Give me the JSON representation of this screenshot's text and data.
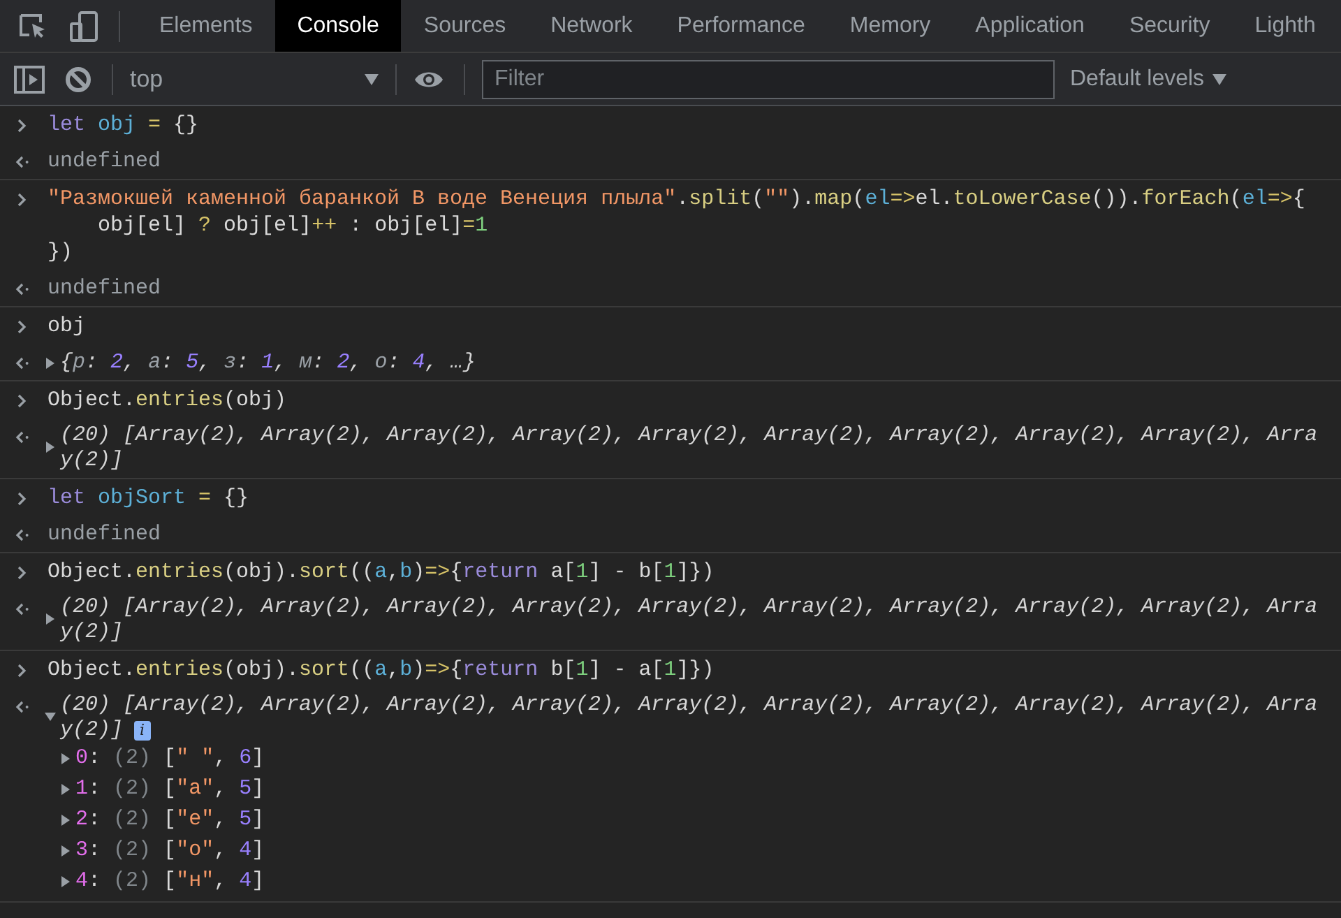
{
  "tabs": [
    {
      "label": "Elements",
      "selected": false
    },
    {
      "label": "Console",
      "selected": true
    },
    {
      "label": "Sources",
      "selected": false
    },
    {
      "label": "Network",
      "selected": false
    },
    {
      "label": "Performance",
      "selected": false
    },
    {
      "label": "Memory",
      "selected": false
    },
    {
      "label": "Application",
      "selected": false
    },
    {
      "label": "Security",
      "selected": false
    },
    {
      "label": "Lighth",
      "selected": false
    }
  ],
  "toolbar": {
    "context": "top",
    "filter_placeholder": "Filter",
    "levels": "Default levels"
  },
  "entries": [
    {
      "command": [
        [
          {
            "keyword": "let "
          },
          {
            "variable": "obj "
          },
          {
            "operator": "= "
          },
          {
            "plain": "{}"
          }
        ]
      ],
      "result": {
        "kind": "text",
        "text": "undefined"
      }
    },
    {
      "command": [
        [
          {
            "string": "\"Размокшей каменной баранкой В воде Венеция плыла\""
          },
          {
            "plain": "."
          },
          {
            "function": "split"
          },
          {
            "plain": "("
          },
          {
            "string": "\"\""
          },
          {
            "plain": ")."
          },
          {
            "function": "map"
          },
          {
            "plain": "("
          },
          {
            "variable": "el"
          },
          {
            "operator": "=>"
          },
          {
            "plain": "el."
          },
          {
            "function": "toLowerCase"
          },
          {
            "plain": "())."
          },
          {
            "function": "forEach"
          },
          {
            "plain": "("
          },
          {
            "variable": "el"
          },
          {
            "operator": "=>"
          },
          {
            "plain": "{"
          }
        ],
        [
          {
            "plain": "    obj[el] "
          },
          {
            "operator": "?"
          },
          {
            "plain": " obj[el]"
          },
          {
            "operator": "++"
          },
          {
            "plain": " : obj[el]"
          },
          {
            "operator": "="
          },
          {
            "number": "1"
          }
        ],
        [
          {
            "plain": "})"
          }
        ]
      ],
      "result": {
        "kind": "text",
        "text": "undefined"
      }
    },
    {
      "command": [
        [
          {
            "plain": "obj"
          }
        ]
      ],
      "result": {
        "kind": "object",
        "expanded": false,
        "tokens": [
          {
            "punct": "{"
          },
          {
            "key": "р"
          },
          {
            "punct": ": "
          },
          {
            "value": "2"
          },
          {
            "punct": ", "
          },
          {
            "key": "а"
          },
          {
            "punct": ": "
          },
          {
            "value": "5"
          },
          {
            "punct": ", "
          },
          {
            "key": "з"
          },
          {
            "punct": ": "
          },
          {
            "value": "1"
          },
          {
            "punct": ", "
          },
          {
            "key": "м"
          },
          {
            "punct": ": "
          },
          {
            "value": "2"
          },
          {
            "punct": ", "
          },
          {
            "key": "о"
          },
          {
            "punct": ": "
          },
          {
            "value": "4"
          },
          {
            "punct": ", …}"
          }
        ]
      }
    },
    {
      "command": [
        [
          {
            "plain": "Object."
          },
          {
            "function": "entries"
          },
          {
            "plain": "(obj)"
          }
        ]
      ],
      "result": {
        "kind": "array",
        "expanded": false,
        "lines": [
          "(20) [Array(2), Array(2), Array(2), Array(2), Array(2), Array(2), Array(2), Array(2), Array(2), Arra",
          "y(2)]"
        ]
      }
    },
    {
      "command": [
        [
          {
            "keyword": "let "
          },
          {
            "variable": "objSort "
          },
          {
            "operator": "= "
          },
          {
            "plain": "{}"
          }
        ]
      ],
      "result": {
        "kind": "text",
        "text": "undefined"
      }
    },
    {
      "command": [
        [
          {
            "plain": "Object."
          },
          {
            "function": "entries"
          },
          {
            "plain": "(obj)."
          },
          {
            "function": "sort"
          },
          {
            "plain": "(("
          },
          {
            "variable": "a"
          },
          {
            "plain": ","
          },
          {
            "variable": "b"
          },
          {
            "plain": ")"
          },
          {
            "operator": "=>"
          },
          {
            "plain": "{"
          },
          {
            "keyword": "return"
          },
          {
            "plain": " a["
          },
          {
            "number": "1"
          },
          {
            "plain": "] - b["
          },
          {
            "number": "1"
          },
          {
            "plain": "]})"
          }
        ]
      ],
      "result": {
        "kind": "array",
        "expanded": false,
        "lines": [
          "(20) [Array(2), Array(2), Array(2), Array(2), Array(2), Array(2), Array(2), Array(2), Array(2), Arra",
          "y(2)]"
        ]
      }
    },
    {
      "command": [
        [
          {
            "plain": "Object."
          },
          {
            "function": "entries"
          },
          {
            "plain": "(obj)."
          },
          {
            "function": "sort"
          },
          {
            "plain": "(("
          },
          {
            "variable": "a"
          },
          {
            "plain": ","
          },
          {
            "variable": "b"
          },
          {
            "plain": ")"
          },
          {
            "operator": "=>"
          },
          {
            "plain": "{"
          },
          {
            "keyword": "return"
          },
          {
            "plain": " b["
          },
          {
            "number": "1"
          },
          {
            "plain": "] - a["
          },
          {
            "number": "1"
          },
          {
            "plain": "]})"
          }
        ]
      ],
      "result": {
        "kind": "array",
        "expanded": true,
        "lines": [
          "(20) [Array(2), Array(2), Array(2), Array(2), Array(2), Array(2), Array(2), Array(2), Array(2), Arra",
          "y(2)]"
        ],
        "badge": "i",
        "items": [
          {
            "expanded": false,
            "tokens": [
              {
                "index": "0"
              },
              {
                "punct": ": "
              },
              {
                "count": "(2) "
              },
              {
                "punct": "["
              },
              {
                "string": "\" \""
              },
              {
                "punct": ", "
              },
              {
                "number": "6"
              },
              {
                "punct": "]"
              }
            ]
          },
          {
            "expanded": false,
            "tokens": [
              {
                "index": "1"
              },
              {
                "punct": ": "
              },
              {
                "count": "(2) "
              },
              {
                "punct": "["
              },
              {
                "string": "\"а\""
              },
              {
                "punct": ", "
              },
              {
                "number": "5"
              },
              {
                "punct": "]"
              }
            ]
          },
          {
            "expanded": false,
            "tokens": [
              {
                "index": "2"
              },
              {
                "punct": ": "
              },
              {
                "count": "(2) "
              },
              {
                "punct": "["
              },
              {
                "string": "\"е\""
              },
              {
                "punct": ", "
              },
              {
                "number": "5"
              },
              {
                "punct": "]"
              }
            ]
          },
          {
            "expanded": false,
            "tokens": [
              {
                "index": "3"
              },
              {
                "punct": ": "
              },
              {
                "count": "(2) "
              },
              {
                "punct": "["
              },
              {
                "string": "\"о\""
              },
              {
                "punct": ", "
              },
              {
                "number": "4"
              },
              {
                "punct": "]"
              }
            ]
          },
          {
            "expanded": false,
            "tokens": [
              {
                "index": "4"
              },
              {
                "punct": ": "
              },
              {
                "count": "(2) "
              },
              {
                "punct": "["
              },
              {
                "string": "\"н\""
              },
              {
                "punct": ", "
              },
              {
                "number": "4"
              },
              {
                "punct": "]"
              }
            ]
          }
        ]
      }
    }
  ]
}
